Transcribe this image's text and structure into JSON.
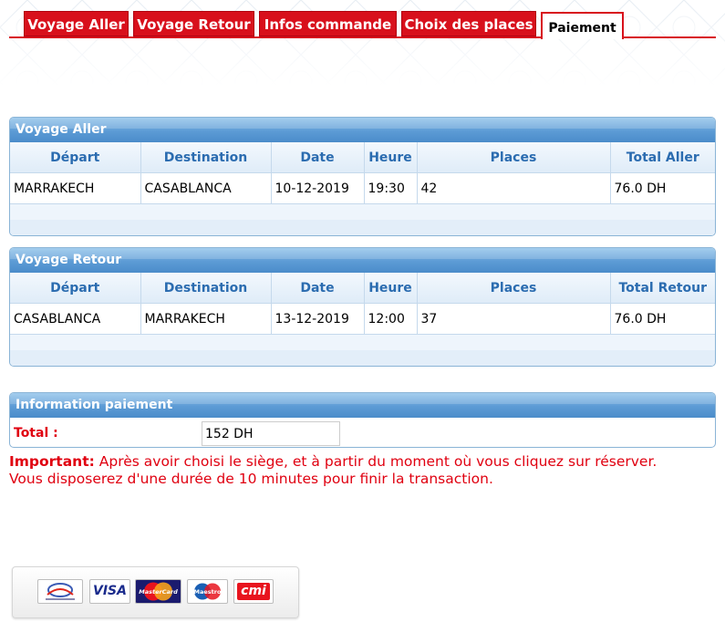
{
  "tabs": [
    {
      "label": "Voyage Aller"
    },
    {
      "label": "Voyage Retour"
    },
    {
      "label": "Infos commande"
    },
    {
      "label": "Choix des places"
    },
    {
      "label": "Paiement",
      "active": true
    }
  ],
  "columns_aller": [
    "Départ",
    "Destination",
    "Date",
    "Heure",
    "Places",
    "Total Aller"
  ],
  "columns_retour": [
    "Départ",
    "Destination",
    "Date",
    "Heure",
    "Places",
    "Total Retour"
  ],
  "aller": {
    "title": "Voyage Aller",
    "row": {
      "depart": "MARRAKECH",
      "destination": "CASABLANCA",
      "date": "10-12-2019",
      "heure": "19:30",
      "places": "42",
      "total": "76.0 DH"
    }
  },
  "retour": {
    "title": "Voyage Retour",
    "row": {
      "depart": "CASABLANCA",
      "destination": "MARRAKECH",
      "date": "13-12-2019",
      "heure": "12:00",
      "places": "37",
      "total": "76.0 DH"
    }
  },
  "payment": {
    "title": "Information paiement",
    "total_label": "Total :",
    "total_value": "152 DH"
  },
  "notice": {
    "strong": "Important:",
    "line1": " Après avoir choisi le siège, et à partir du moment où vous cliquez sur réserver.",
    "line2": "Vous disposerez d'une durée de 10 minutes pour finir la transaction."
  },
  "cards": {
    "visa": "VISA",
    "mastercard": "MasterCard",
    "maestro": "Maestro",
    "cmi": "cmi"
  },
  "colors": {
    "brand_red": "#d8101c",
    "header_blue": "#5c9bd5",
    "text_blue": "#2b6cb0"
  }
}
